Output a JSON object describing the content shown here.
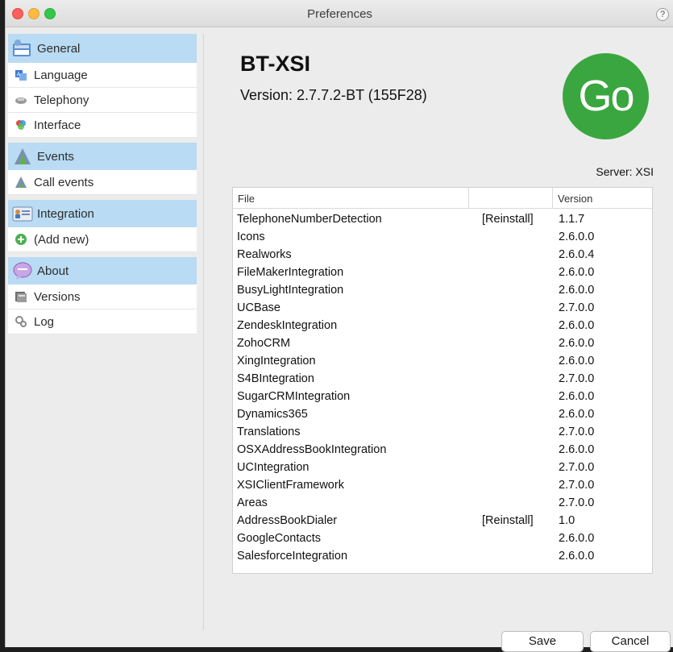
{
  "window": {
    "title": "Preferences",
    "help": "?"
  },
  "sidebar": {
    "sections": [
      {
        "label": "General",
        "icon": "general-settings-icon",
        "items": [
          {
            "label": "Language",
            "icon": "language-icon"
          },
          {
            "label": "Telephony",
            "icon": "telephony-icon"
          },
          {
            "label": "Interface",
            "icon": "interface-icon"
          }
        ]
      },
      {
        "label": "Events",
        "icon": "events-icon",
        "items": [
          {
            "label": "Call events",
            "icon": "call-events-icon"
          }
        ]
      },
      {
        "label": "Integration",
        "icon": "integration-icon",
        "items": [
          {
            "label": "(Add new)",
            "icon": "add-icon"
          }
        ]
      },
      {
        "label": "About",
        "icon": "about-chat-icon",
        "items": [
          {
            "label": "Versions",
            "icon": "versions-icon"
          },
          {
            "label": "Log",
            "icon": "log-icon"
          }
        ]
      }
    ]
  },
  "main": {
    "app_name": "BT-XSI",
    "version": "Version: 2.7.7.2-BT (155F28)",
    "logo_text": "Go",
    "server": "Server: XSI",
    "table": {
      "headers": [
        "File",
        "",
        "Version"
      ],
      "rows": [
        [
          "TelephoneNumberDetection",
          "[Reinstall]",
          "1.1.7"
        ],
        [
          "Icons",
          "",
          "2.6.0.0"
        ],
        [
          "Realworks",
          "",
          "2.6.0.4"
        ],
        [
          "FileMakerIntegration",
          "",
          "2.6.0.0"
        ],
        [
          "BusyLightIntegration",
          "",
          "2.6.0.0"
        ],
        [
          "UCBase",
          "",
          "2.7.0.0"
        ],
        [
          "ZendeskIntegration",
          "",
          "2.6.0.0"
        ],
        [
          "ZohoCRM",
          "",
          "2.6.0.0"
        ],
        [
          "XingIntegration",
          "",
          "2.6.0.0"
        ],
        [
          "S4BIntegration",
          "",
          "2.7.0.0"
        ],
        [
          "SugarCRMIntegration",
          "",
          "2.6.0.0"
        ],
        [
          "Dynamics365",
          "",
          "2.6.0.0"
        ],
        [
          "Translations",
          "",
          "2.7.0.0"
        ],
        [
          "OSXAddressBookIntegration",
          "",
          "2.6.0.0"
        ],
        [
          "UCIntegration",
          "",
          "2.7.0.0"
        ],
        [
          "XSIClientFramework",
          "",
          "2.7.0.0"
        ],
        [
          "Areas",
          "",
          "2.7.0.0"
        ],
        [
          "AddressBookDialer",
          "[Reinstall]",
          "1.0"
        ],
        [
          "GoogleContacts",
          "",
          "2.6.0.0"
        ],
        [
          "SalesforceIntegration",
          "",
          "2.6.0.0"
        ]
      ]
    }
  },
  "footer": {
    "save": "Save",
    "cancel": "Cancel"
  },
  "colors": {
    "section_header": "#b9dbf3",
    "logo": "#3aa63f"
  }
}
